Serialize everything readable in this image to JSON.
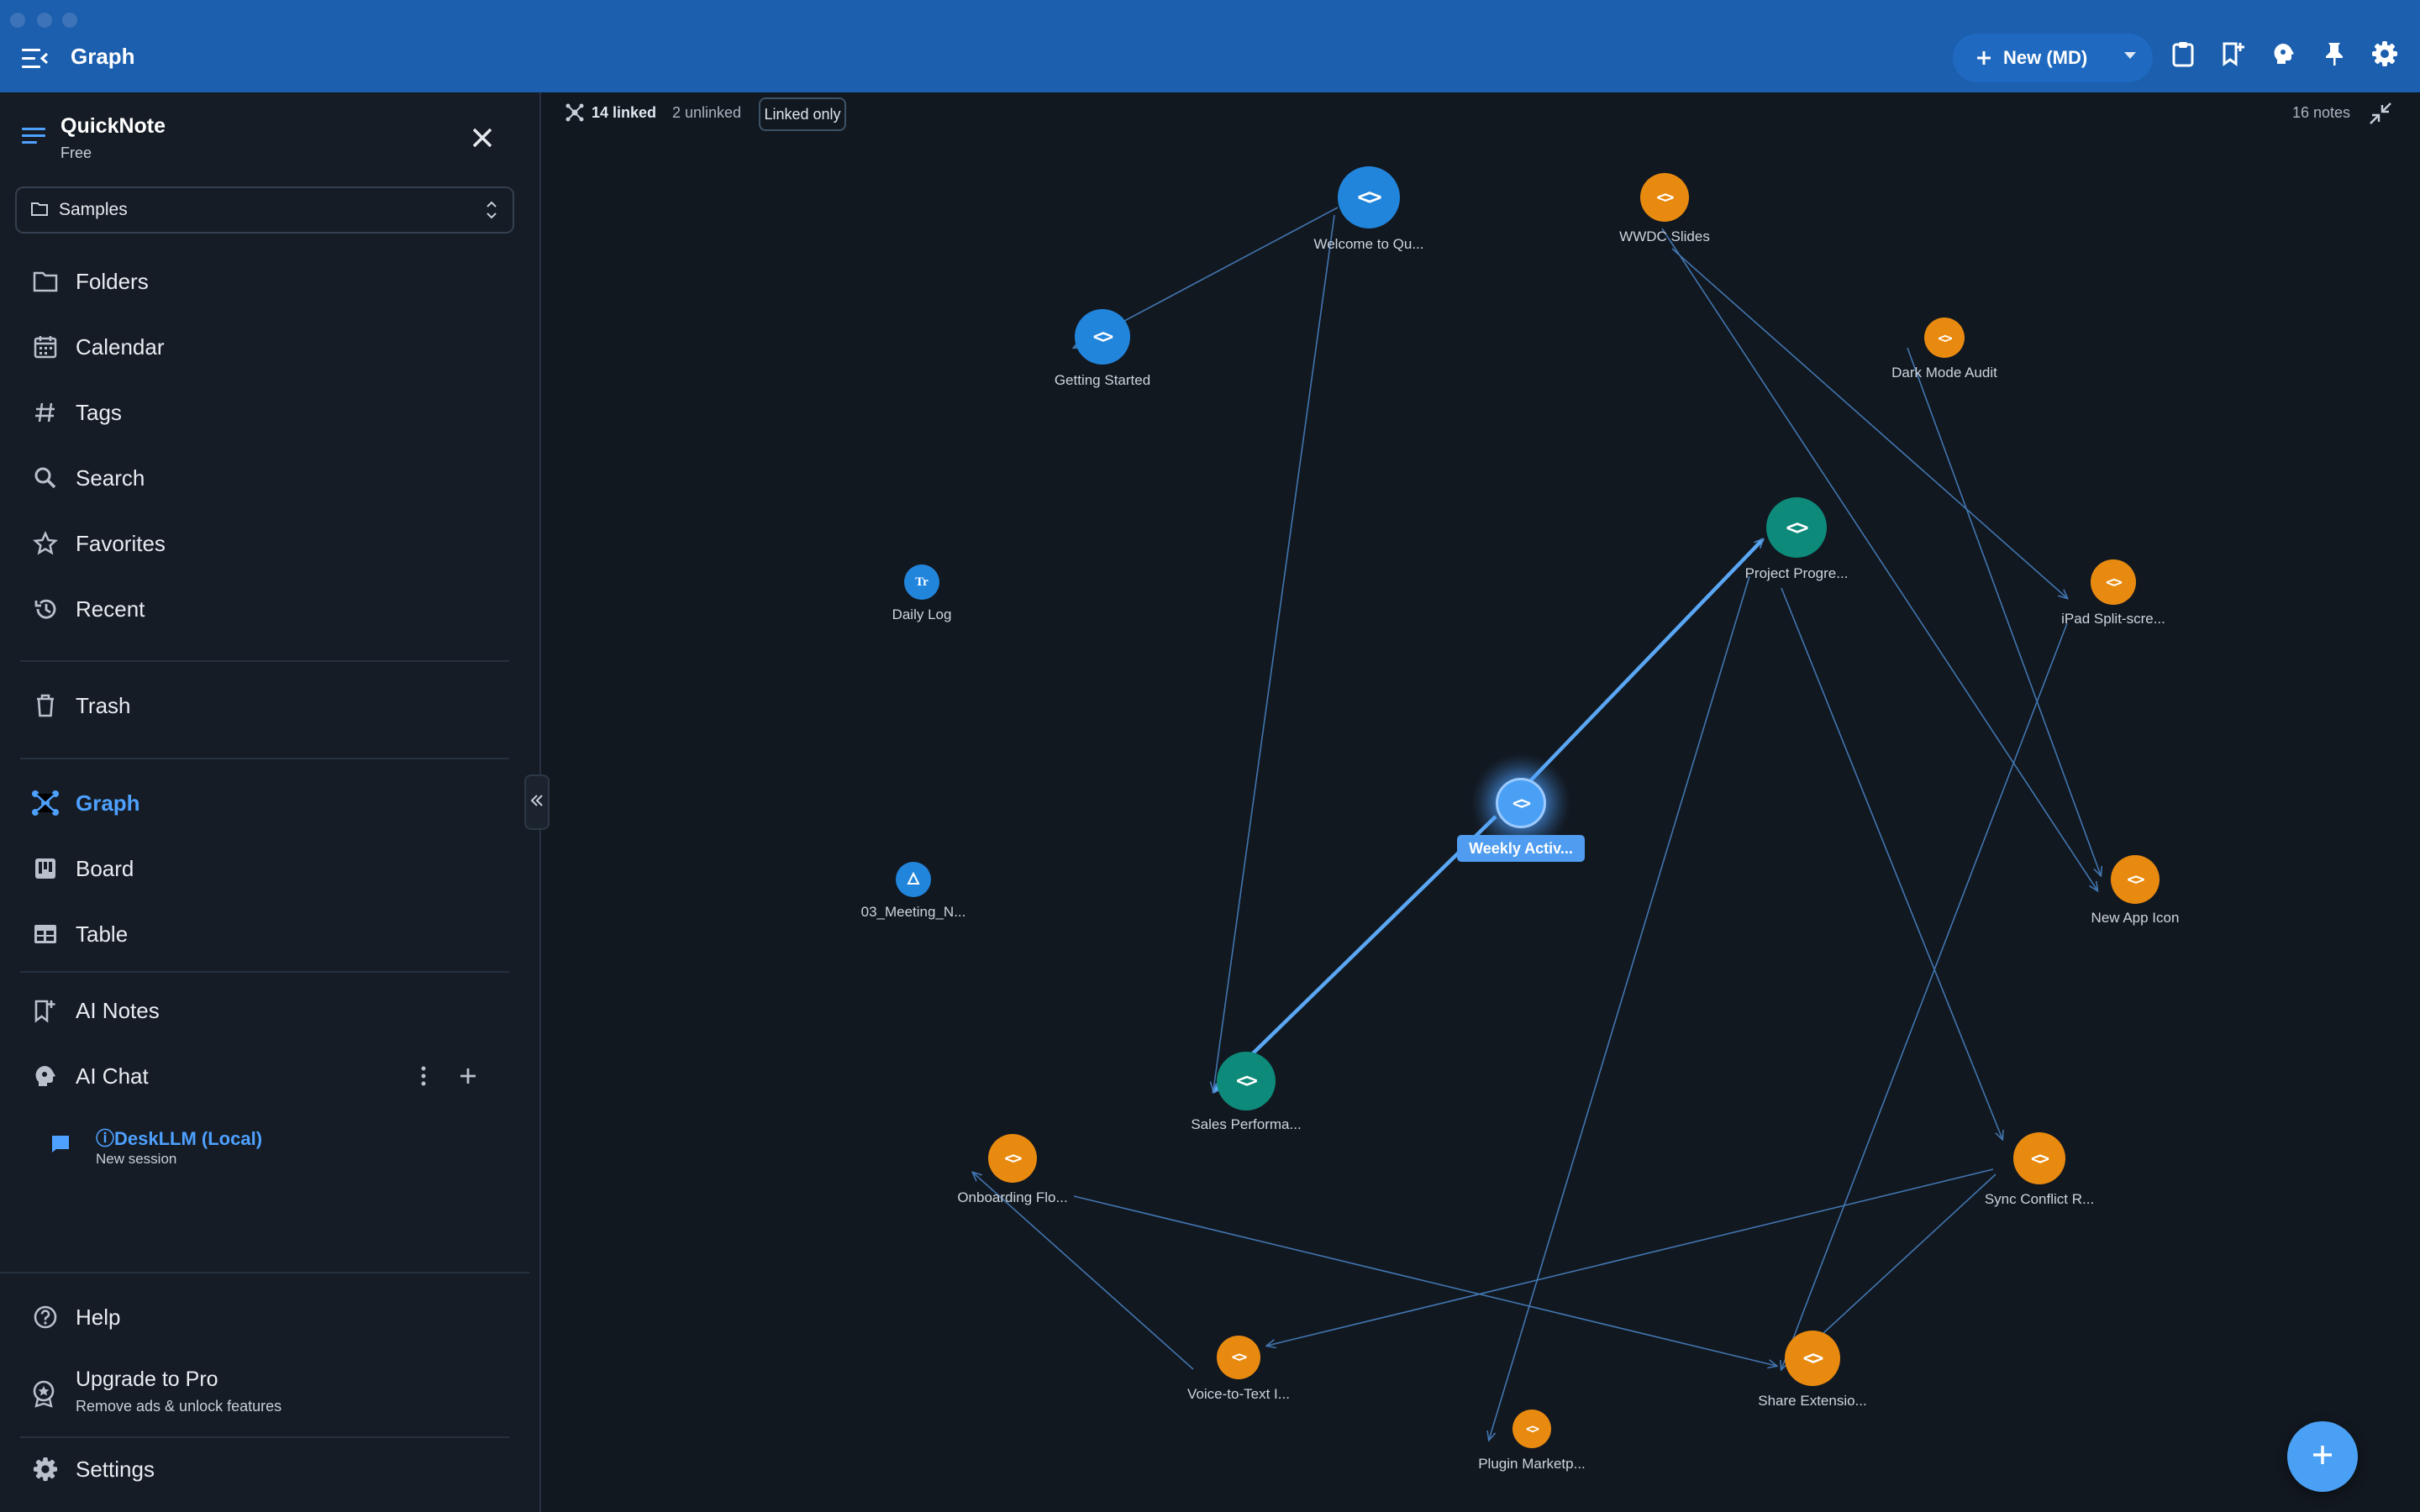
{
  "window": {
    "title": "Graph"
  },
  "toolbar": {
    "new_label": "New (MD)",
    "icons": [
      "plus-icon",
      "clipboard-icon",
      "bookmark-plus-icon",
      "brain-icon",
      "pin-icon",
      "gear-icon"
    ]
  },
  "sidebar": {
    "app_name": "QuickNote",
    "plan": "Free",
    "folder_select": "Samples",
    "nav": [
      {
        "label": "Folders",
        "icon": "folder-icon"
      },
      {
        "label": "Calendar",
        "icon": "calendar-icon"
      },
      {
        "label": "Tags",
        "icon": "hash-icon"
      },
      {
        "label": "Search",
        "icon": "search-icon"
      },
      {
        "label": "Favorites",
        "icon": "star-icon"
      },
      {
        "label": "Recent",
        "icon": "history-icon"
      }
    ],
    "trash": "Trash",
    "views": [
      {
        "label": "Graph",
        "icon": "graph-icon",
        "active": true
      },
      {
        "label": "Board",
        "icon": "board-icon"
      },
      {
        "label": "Table",
        "icon": "table-icon"
      }
    ],
    "ai_notes": "AI Notes",
    "ai_chat": "AI Chat",
    "session": {
      "title": "ⓘDeskLLM (Local)",
      "subtitle": "New session"
    },
    "help": "Help",
    "upgrade": {
      "title": "Upgrade to Pro",
      "subtitle": "Remove ads & unlock features"
    },
    "settings": "Settings"
  },
  "graph": {
    "linked": "14 linked",
    "unlinked": "2 unlinked",
    "linked_only": "Linked only",
    "note_count": "16 notes",
    "accent": "#4ea1ff",
    "nodes": [
      {
        "label": "Welcome to Qu...",
        "kind": "md",
        "color": "blue"
      },
      {
        "label": "WWDC Slides",
        "kind": "md",
        "color": "orange"
      },
      {
        "label": "Getting Started",
        "kind": "md",
        "color": "blue"
      },
      {
        "label": "Dark Mode Audit",
        "kind": "md",
        "color": "orange"
      },
      {
        "label": "Project Progre...",
        "kind": "md",
        "color": "teal"
      },
      {
        "label": "iPad Split-scre...",
        "kind": "md",
        "color": "orange"
      },
      {
        "label": "Daily Log",
        "kind": "text",
        "color": "blue"
      },
      {
        "label": "Weekly Activ...",
        "kind": "md",
        "color": "blue",
        "selected": true
      },
      {
        "label": "03_Meeting_N...",
        "kind": "drawing",
        "color": "blue"
      },
      {
        "label": "New App Icon",
        "kind": "md",
        "color": "orange"
      },
      {
        "label": "Sales Performa...",
        "kind": "md",
        "color": "teal"
      },
      {
        "label": "Onboarding Flo...",
        "kind": "md",
        "color": "orange"
      },
      {
        "label": "Sync Conflict R...",
        "kind": "md",
        "color": "orange"
      },
      {
        "label": "Voice-to-Text I...",
        "kind": "md",
        "color": "orange"
      },
      {
        "label": "Share Extensio...",
        "kind": "md",
        "color": "orange"
      },
      {
        "label": "Plugin Marketp...",
        "kind": "md",
        "color": "orange"
      }
    ]
  }
}
